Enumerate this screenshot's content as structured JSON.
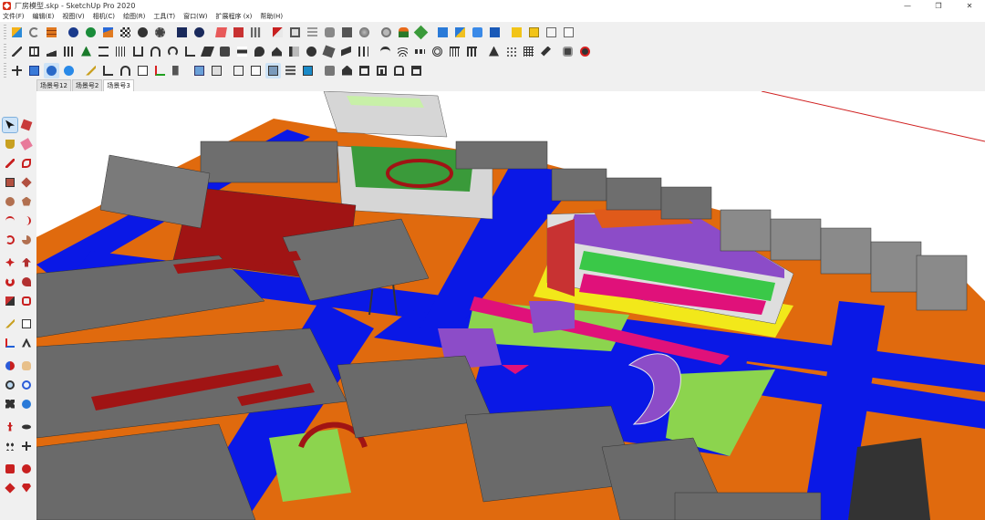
{
  "window": {
    "title": "厂房模型.skp - SketchUp Pro 2020",
    "minimize_glyph": "—",
    "maximize_glyph": "❐",
    "close_glyph": "✕"
  },
  "menu": [
    {
      "label": "文件(F)"
    },
    {
      "label": "编辑(E)"
    },
    {
      "label": "视图(V)"
    },
    {
      "label": "相机(C)"
    },
    {
      "label": "绘图(R)"
    },
    {
      "label": "工具(T)"
    },
    {
      "label": "窗口(W)"
    },
    {
      "label": "扩展程序 (x)"
    },
    {
      "label": "帮助(H)"
    }
  ],
  "scenes": [
    {
      "label": "场景号12"
    },
    {
      "label": "场景号2"
    },
    {
      "label": "场景号3"
    }
  ],
  "colors": {
    "ground_orange": "#e06a0e",
    "road_blue": "#0a18e6",
    "roof_gray": "#6e6e6e",
    "brick_red": "#a01414",
    "grass_green": "#8cd44e",
    "magenta": "#e0117a",
    "purple": "#8c4cc8",
    "yellow": "#f2e81a"
  }
}
